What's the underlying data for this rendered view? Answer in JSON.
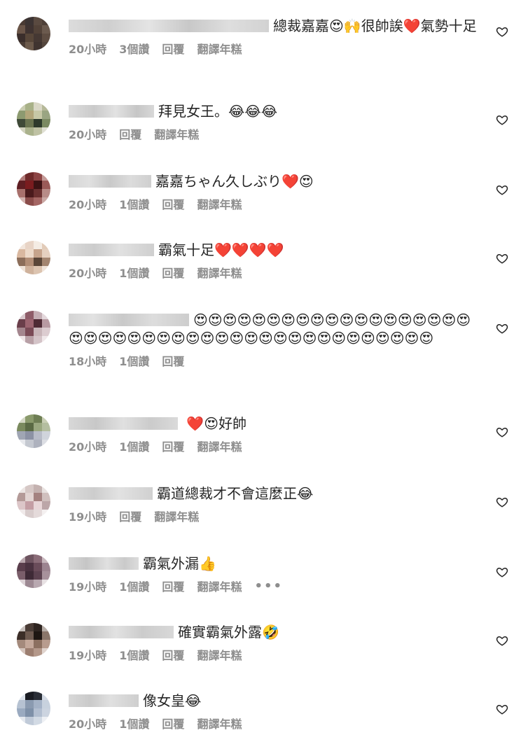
{
  "comments": [
    {
      "text": "總裁嘉嘉😍🙌很帥誒❤️氣勢十足",
      "time": "20小時",
      "likes": "3個讚",
      "reply": "回覆",
      "translate": "翻譯年糕",
      "more": ""
    },
    {
      "text": "拜見女王。😂😂😂",
      "time": "20小時",
      "likes": "",
      "reply": "回覆",
      "translate": "翻譯年糕",
      "more": ""
    },
    {
      "text": "嘉嘉ちゃん久しぶり❤️😍",
      "time": "20小時",
      "likes": "1個讚",
      "reply": "回覆",
      "translate": "翻譯年糕",
      "more": ""
    },
    {
      "text": "霸氣十足❤️❤️❤️❤️",
      "time": "20小時",
      "likes": "1個讚",
      "reply": "回覆",
      "translate": "翻譯年糕",
      "more": ""
    },
    {
      "text": "😍😍😍😍😍😍😍😍😍😍😍😍😍😍😍😍😍😍😍😍😍😍😍😍😍😍😍😍😍😍😍😍😍😍😍😍😍😍😍😍😍😍😍😍",
      "time": "18小時",
      "likes": "1個讚",
      "reply": "回覆",
      "translate": "",
      "more": ""
    },
    {
      "text": " ❤️😍好帥",
      "time": "20小時",
      "likes": "1個讚",
      "reply": "回覆",
      "translate": "翻譯年糕",
      "more": ""
    },
    {
      "text": "霸道總裁才不會這麼正😂",
      "time": "19小時",
      "likes": "",
      "reply": "回覆",
      "translate": "翻譯年糕",
      "more": ""
    },
    {
      "text": "霸氣外漏👍",
      "time": "19小時",
      "likes": "1個讚",
      "reply": "回覆",
      "translate": "翻譯年糕",
      "more": "•••"
    },
    {
      "text": "確實霸氣外露🤣",
      "time": "19小時",
      "likes": "1個讚",
      "reply": "回覆",
      "translate": "翻譯年糕",
      "more": ""
    },
    {
      "text": "像女皇😂",
      "time": "20小時",
      "likes": "1個讚",
      "reply": "回覆",
      "translate": "翻譯年糕",
      "more": ""
    }
  ],
  "icons": {
    "like": "heart-outline-icon",
    "options": "more-options-icon"
  },
  "colors": {
    "meta": "#8e8e8e",
    "text": "#262626"
  }
}
